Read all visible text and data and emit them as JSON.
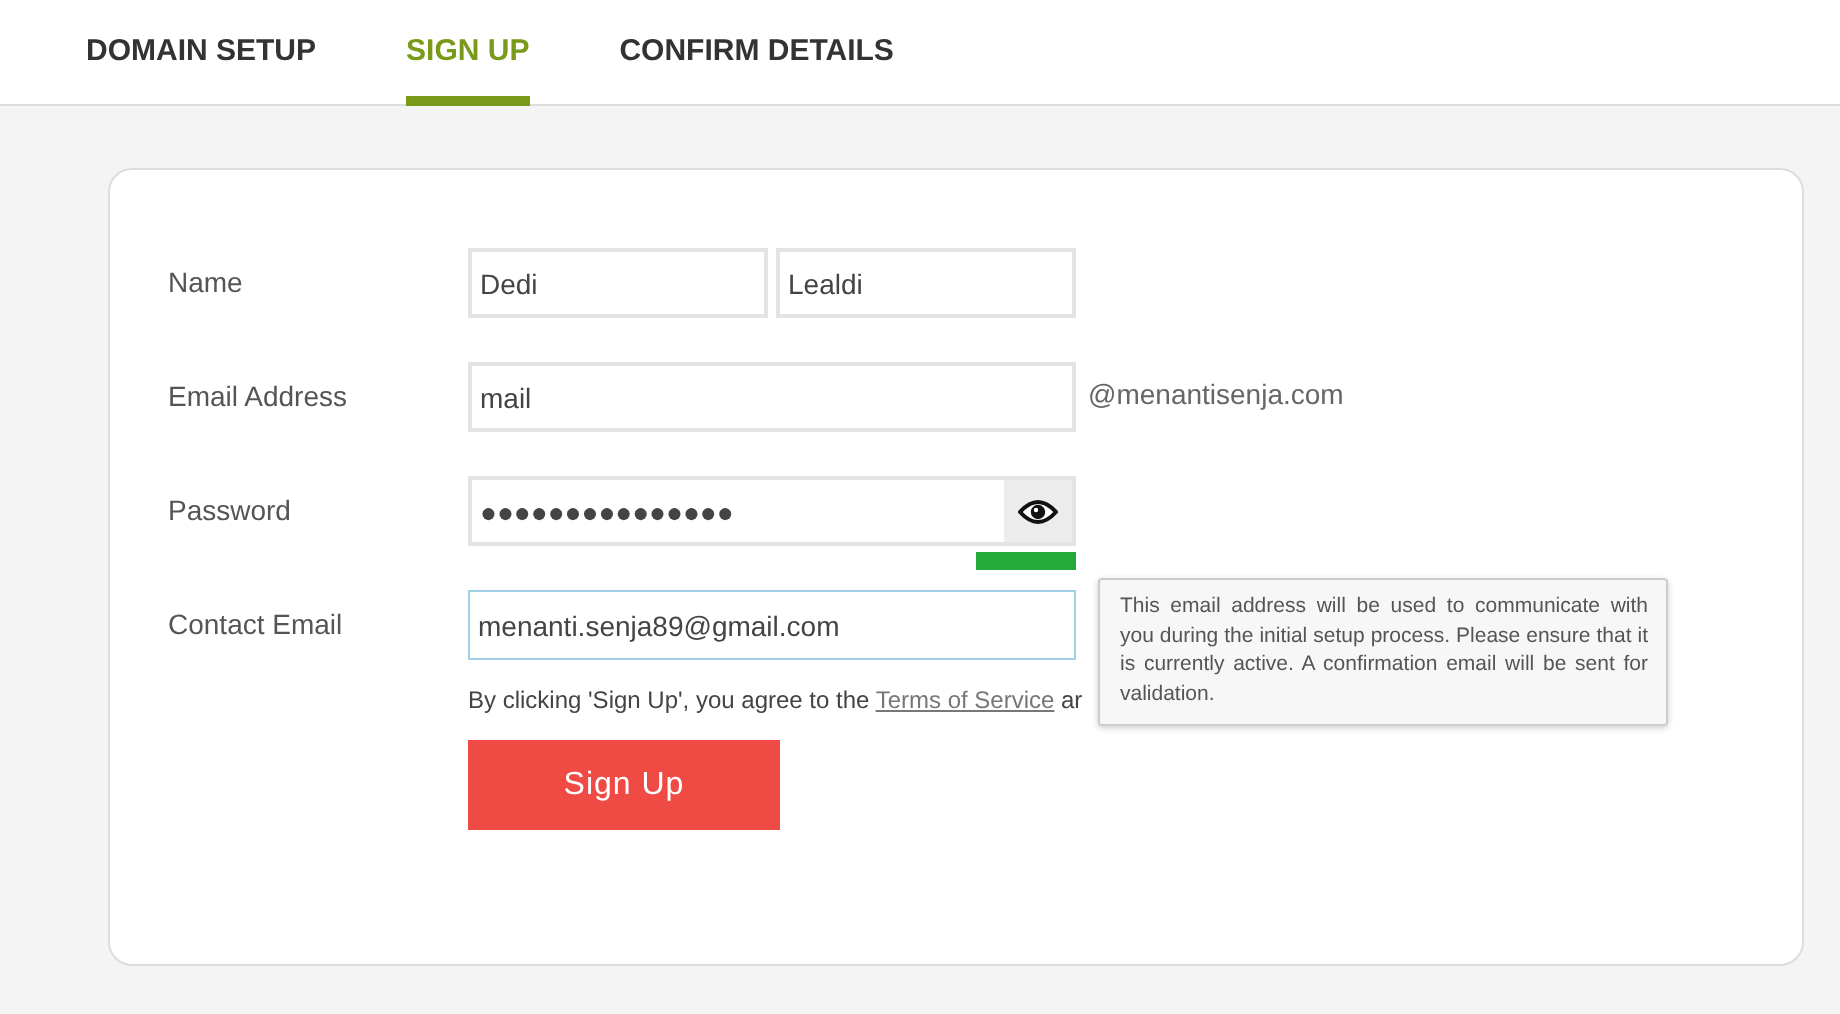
{
  "tabs": [
    {
      "label": "DOMAIN SETUP",
      "selected": false
    },
    {
      "label": "SIGN UP",
      "selected": true
    },
    {
      "label": "CONFIRM DETAILS",
      "selected": false
    }
  ],
  "form": {
    "name": {
      "label": "Name",
      "first": "Dedi",
      "last": "Lealdi"
    },
    "email": {
      "label": "Email Address",
      "value": "mail",
      "suffix": "@menantisenja.com"
    },
    "password": {
      "label": "Password",
      "value": "●●●●●●●●●●●●●●●"
    },
    "contact": {
      "label": "Contact Email",
      "value": "menanti.senja89@gmail.com",
      "focused": true,
      "tooltip": "This email address will be used to communicate with you during the initial setup process. Please ensure that it is currently active. A confirmation email will be sent for validation."
    },
    "consent": {
      "before": "By clicking 'Sign Up', you agree to the ",
      "link": "Terms of Service",
      "after": " ar"
    },
    "submit": "Sign Up"
  }
}
